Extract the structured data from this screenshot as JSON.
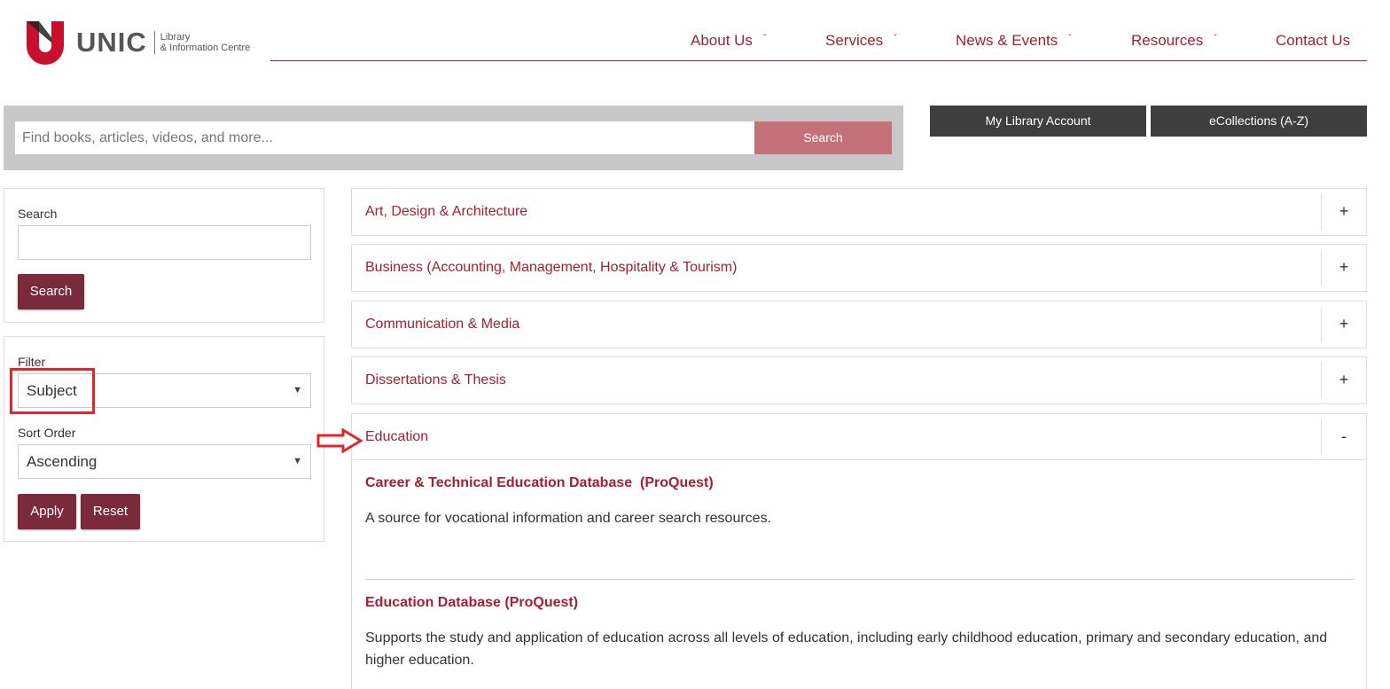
{
  "brand": {
    "name": "UNIC",
    "subtitle_line1": "Library",
    "subtitle_line2": "& Information Centre",
    "color": "#c8102e"
  },
  "nav": {
    "items": [
      {
        "label": "About Us",
        "has_dropdown": true
      },
      {
        "label": "Services",
        "has_dropdown": true
      },
      {
        "label": "News & Events",
        "has_dropdown": true
      },
      {
        "label": "Resources",
        "has_dropdown": true
      },
      {
        "label": "Contact Us",
        "has_dropdown": false
      }
    ],
    "dropdown_glyph": "ˇ"
  },
  "search_band": {
    "placeholder": "Find books, articles, videos, and more...",
    "button_label": "Search"
  },
  "quick_links": {
    "account": "My Library Account",
    "ecollections": "eCollections (A-Z)"
  },
  "sidebar": {
    "search_panel": {
      "label": "Search",
      "input_value": "",
      "button_label": "Search"
    },
    "filter_panel": {
      "filter_label": "Filter",
      "filter_value": "Subject",
      "sort_label": "Sort Order",
      "sort_value": "Ascending",
      "apply_label": "Apply",
      "reset_label": "Reset"
    }
  },
  "accordion": {
    "expand_glyph": "+",
    "collapse_glyph": "-",
    "sections": [
      {
        "title": "Art, Design & Architecture",
        "expanded": false
      },
      {
        "title": "Business (Accounting, Management, Hospitality & Tourism)",
        "expanded": false
      },
      {
        "title": "Communication & Media",
        "expanded": false
      },
      {
        "title": "Dissertations & Thesis",
        "expanded": false
      },
      {
        "title": "Education",
        "expanded": true
      }
    ],
    "entries": [
      {
        "title": "Career & Technical Education Database  (ProQuest)",
        "description": "A source for vocational information and career search resources."
      },
      {
        "title": "Education Database (ProQuest)",
        "description": "Supports the study and application of education across all levels of education, including early childhood education, primary and secondary education, and higher education."
      }
    ]
  },
  "colors": {
    "accent": "#a31f34",
    "button_maroon": "#7a2a3a",
    "search_button": "#c5717a",
    "dark_button": "#3e3e3e",
    "highlight": "#e0262b"
  }
}
